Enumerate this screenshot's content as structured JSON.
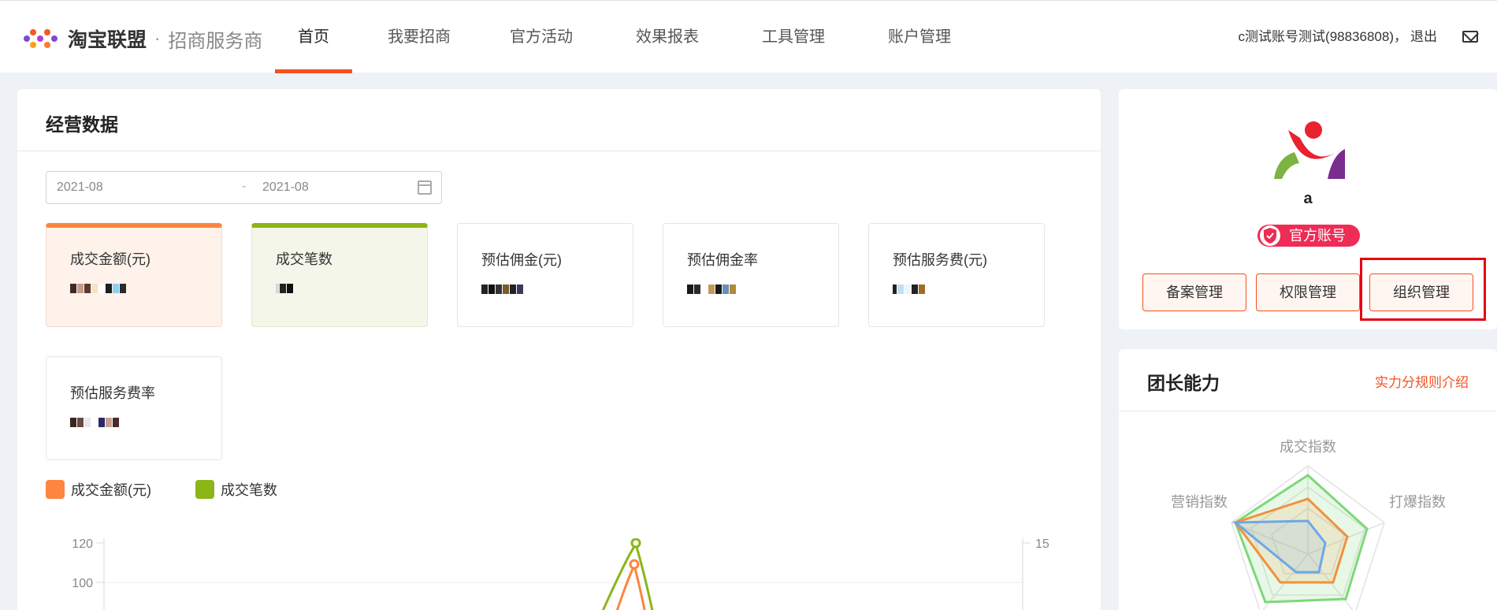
{
  "header": {
    "logo_text": "淘宝联盟",
    "logo_dot": "·",
    "logo_sub": "招商服务商",
    "nav": [
      {
        "label": "首页",
        "active": true
      },
      {
        "label": "我要招商",
        "active": false
      },
      {
        "label": "官方活动",
        "active": false
      },
      {
        "label": "效果报表",
        "active": false
      },
      {
        "label": "工具管理",
        "active": false
      },
      {
        "label": "账户管理",
        "active": false
      }
    ],
    "user_text": "c测试账号测试(98836808)，",
    "logout": "退出"
  },
  "business": {
    "title": "经营数据",
    "date_start": "2021-08",
    "date_sep": "-",
    "date_end": "2021-08",
    "stats": [
      {
        "label": "成交金额(元)",
        "accent": "#fd853f"
      },
      {
        "label": "成交笔数",
        "accent": "#8cb518"
      },
      {
        "label": "预估佣金(元)"
      },
      {
        "label": "预估佣金率"
      },
      {
        "label": "预估服务费(元)"
      },
      {
        "label": "预估服务费率"
      }
    ],
    "legend": [
      {
        "label": "成交金额(元)",
        "color": "#fd853f"
      },
      {
        "label": "成交笔数",
        "color": "#8cb518"
      }
    ]
  },
  "chart_data": {
    "type": "line",
    "left_axis_ticks": [
      "120",
      "100"
    ],
    "right_axis_ticks": [
      "15"
    ],
    "series": [
      {
        "name": "成交金额(元)",
        "color": "#fd853f",
        "peak_value": 108
      },
      {
        "name": "成交笔数",
        "color": "#8cb518",
        "peak_value": 120
      }
    ]
  },
  "profile": {
    "name": "a",
    "badge": "官方账号",
    "buttons": [
      "备案管理",
      "权限管理",
      "组织管理"
    ]
  },
  "ability": {
    "title": "团长能力",
    "link": "实力分规则介绍",
    "axes": [
      "成交指数",
      "打爆指数",
      "营销指数"
    ],
    "colors": {
      "outer": "#7dd87a",
      "mid": "#f2913d",
      "inner": "#6ea7e8"
    }
  }
}
